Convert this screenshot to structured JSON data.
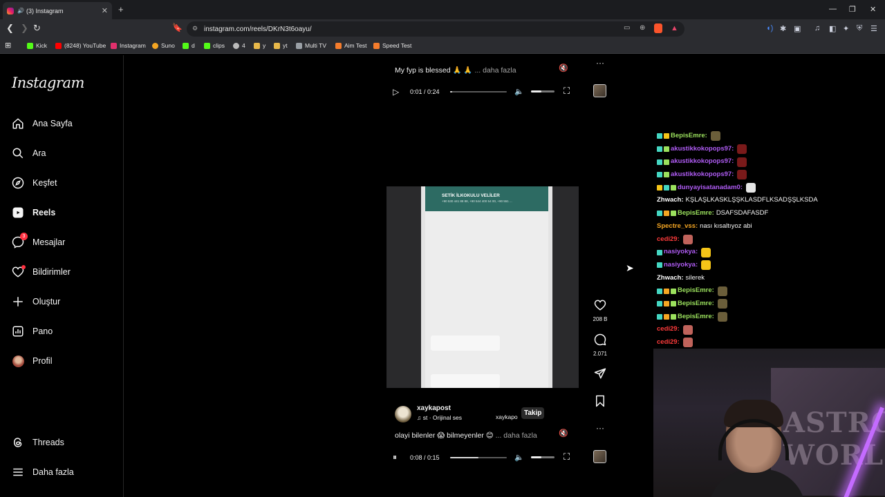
{
  "browser": {
    "tab_title": "(3) Instagram",
    "tab_speaker": "🔊",
    "new_tab": "+",
    "url": "instagram.com/reels/DKrN3t6oayu/",
    "window_controls": [
      "—",
      "❐",
      "✕"
    ],
    "bookmarks": [
      {
        "label": "Kick",
        "color": "#53fc18"
      },
      {
        "label": "(8248) YouTube",
        "color": "#ff0000"
      },
      {
        "label": "Instagram",
        "color": "#e1306c"
      },
      {
        "label": "Suno",
        "color": "#f5a623"
      },
      {
        "label": "d",
        "color": "#53fc18"
      },
      {
        "label": "clips",
        "color": "#53fc18"
      },
      {
        "label": "4",
        "color": "#bbbbbb"
      },
      {
        "label": "y",
        "color": "#e8b84a"
      },
      {
        "label": "yt",
        "color": "#e8b84a"
      },
      {
        "label": "Multi TV",
        "color": "#9aa0a6"
      },
      {
        "label": "Aim Test",
        "color": "#f47c2c"
      },
      {
        "label": "Speed Test",
        "color": "#f47c2c"
      }
    ]
  },
  "sidebar": {
    "logo": "Instagram",
    "items": [
      {
        "label": "Ana Sayfa",
        "icon": "home-icon"
      },
      {
        "label": "Ara",
        "icon": "search-icon"
      },
      {
        "label": "Keşfet",
        "icon": "compass-icon"
      },
      {
        "label": "Reels",
        "icon": "reels-icon",
        "active": true
      },
      {
        "label": "Mesajlar",
        "icon": "messenger-icon",
        "badge": "3"
      },
      {
        "label": "Bildirimler",
        "icon": "heart-icon"
      },
      {
        "label": "Oluştur",
        "icon": "plus-icon"
      },
      {
        "label": "Pano",
        "icon": "dashboard-icon"
      },
      {
        "label": "Profil",
        "icon": "avatar"
      }
    ],
    "bottom": [
      {
        "label": "Threads",
        "icon": "threads-icon"
      },
      {
        "label": "Daha fazla",
        "icon": "menu-icon"
      }
    ]
  },
  "reel1": {
    "caption": "My fyp is blessed 🙏 🙏",
    "more": "... daha fazla",
    "time": "0:01 / 0:24",
    "progress": 0.04,
    "volume": 0.45
  },
  "reel2": {
    "video_header": "SETİK İLKOKULU VELİLER",
    "video_sub": "+90 530 441 88 88, +90 544 400 54 00, +90 551 ...",
    "likes": "208 B",
    "comments": "2.071",
    "author": "xaykapost",
    "audio": "st · Orijinal ses",
    "author_repeat": "xaykapo",
    "follow": "Takip",
    "caption": "olayi bilenler 😱 bilmeyenler 😊",
    "more": "... daha fazla",
    "time": "0:08 / 0:15",
    "progress": 0.5,
    "volume": 0.45
  },
  "chat": [
    {
      "user": "BepisEmre",
      "color": "#9be15d",
      "text": "",
      "emote": "#6b5e3a",
      "badges": [
        "#44d6c2",
        "#f5c518"
      ]
    },
    {
      "user": "akustikkokopops97",
      "color": "#b05cf5",
      "text": "",
      "emote": "#7a1a1a",
      "badges": [
        "#44d6c2",
        "#9be15d"
      ]
    },
    {
      "user": "akustikkokopops97",
      "color": "#b05cf5",
      "text": "",
      "emote": "#7a1a1a",
      "badges": [
        "#44d6c2",
        "#9be15d"
      ]
    },
    {
      "user": "akustikkokopops97",
      "color": "#b05cf5",
      "text": "",
      "emote": "#7a1a1a",
      "badges": [
        "#44d6c2",
        "#9be15d"
      ]
    },
    {
      "user": "dunyayisatanadam0",
      "color": "#b05cf5",
      "text": "",
      "emote": "#e6e6e6",
      "badges": [
        "#f5c518",
        "#44d6c2",
        "#9be15d"
      ]
    },
    {
      "user": "Zhwach",
      "color": "#ffffff",
      "text": "KŞLAŞLKASKLŞŞKLASDFLKSADŞŞLKSDA",
      "emote": "",
      "badges": []
    },
    {
      "user": "BepisEmre",
      "color": "#9be15d",
      "text": "DSAFSDAFASDF",
      "emote": "",
      "badges": [
        "#44d6c2",
        "#f5a623",
        "#9be15d"
      ]
    },
    {
      "user": "Spectre_vss",
      "color": "#f5a623",
      "text": "nası kısaltıyoz abi",
      "emote": "",
      "badges": []
    },
    {
      "user": "cedi29",
      "color": "#ff3b3b",
      "text": "",
      "emote": "#c0635b",
      "badges": []
    },
    {
      "user": "nasiyokya",
      "color": "#b05cf5",
      "text": "",
      "emote": "#f5c518",
      "badges": [
        "#44d6c2"
      ]
    },
    {
      "user": "nasiyokya",
      "color": "#b05cf5",
      "text": "",
      "emote": "#f5c518",
      "badges": [
        "#44d6c2"
      ]
    },
    {
      "user": "Zhwach",
      "color": "#ffffff",
      "text": "silerek",
      "emote": "",
      "badges": []
    },
    {
      "user": "BepisEmre",
      "color": "#9be15d",
      "text": "",
      "emote": "#6b5e3a",
      "badges": [
        "#44d6c2",
        "#f5a623",
        "#9be15d"
      ]
    },
    {
      "user": "BepisEmre",
      "color": "#9be15d",
      "text": "",
      "emote": "#6b5e3a",
      "badges": [
        "#44d6c2",
        "#f5a623",
        "#9be15d"
      ]
    },
    {
      "user": "BepisEmre",
      "color": "#9be15d",
      "text": "",
      "emote": "#6b5e3a",
      "badges": [
        "#44d6c2",
        "#f5a623",
        "#9be15d"
      ]
    },
    {
      "user": "cedi29",
      "color": "#ff3b3b",
      "text": "",
      "emote": "#c0635b",
      "badges": []
    },
    {
      "user": "cedi29",
      "color": "#ff3b3b",
      "text": "",
      "emote": "#c0635b",
      "badges": []
    }
  ],
  "webcam": {
    "poster_text": "ASTRO WORLD"
  }
}
